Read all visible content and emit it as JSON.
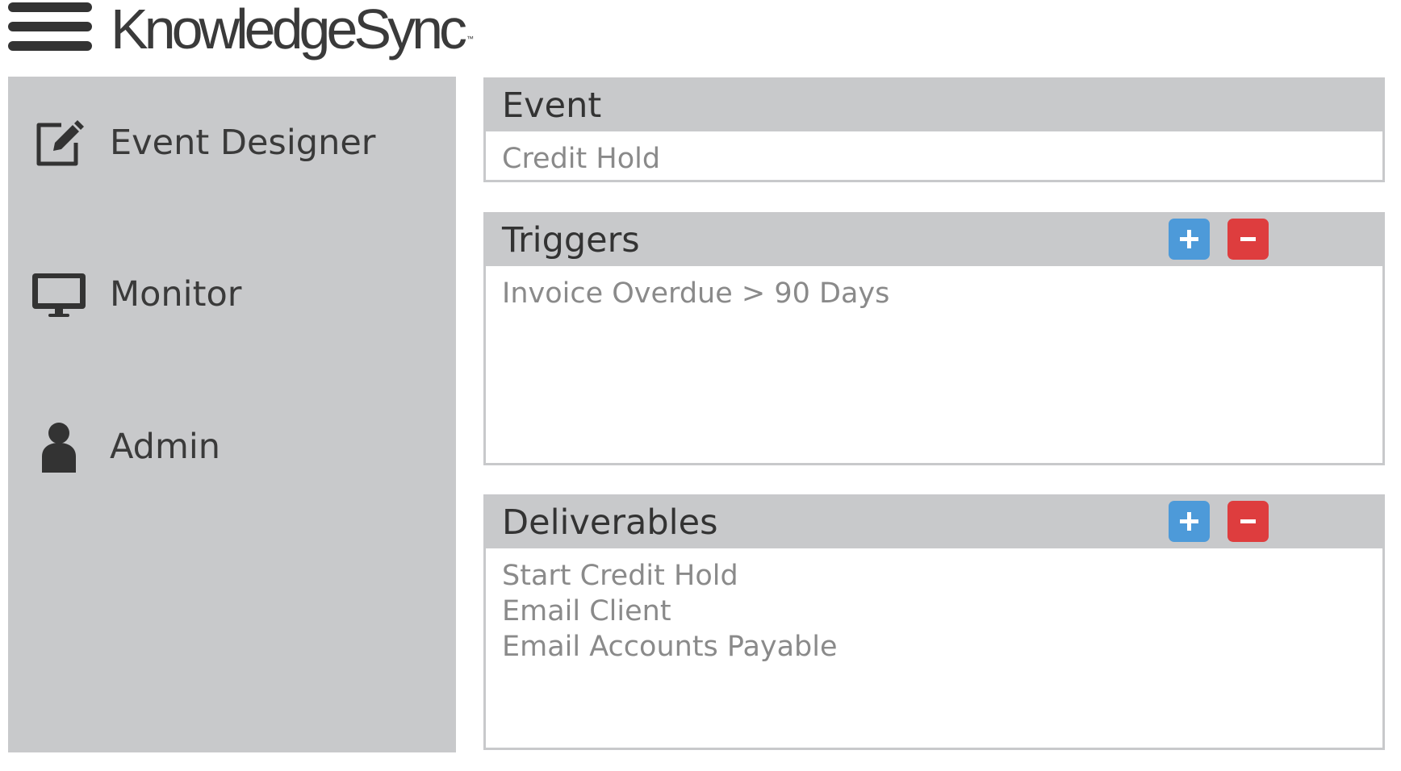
{
  "app": {
    "name": "KnowledgeSync",
    "trademark": "™"
  },
  "header": {
    "menu_icon": "hamburger-menu-icon"
  },
  "sidebar": {
    "items": [
      {
        "label": "Event Designer",
        "icon": "edit-icon"
      },
      {
        "label": "Monitor",
        "icon": "monitor-icon"
      },
      {
        "label": "Admin",
        "icon": "user-icon"
      }
    ]
  },
  "panels": {
    "event": {
      "title": "Event",
      "value": "Credit Hold"
    },
    "triggers": {
      "title": "Triggers",
      "items": [
        "Invoice Overdue > 90 Days"
      ],
      "add_symbol": "+",
      "remove_symbol": "−"
    },
    "deliverables": {
      "title": "Deliverables",
      "items": [
        "Start Credit Hold",
        "Email Client",
        "Email Accounts Payable"
      ],
      "add_symbol": "+",
      "remove_symbol": "−"
    }
  },
  "colors": {
    "sidebar_bg": "#c8c9cb",
    "panel_header_bg": "#c8c9cb",
    "add_button": "#4d9ad9",
    "remove_button": "#de3d3e",
    "text_dark": "#333333",
    "text_muted": "#8a8a8a"
  }
}
